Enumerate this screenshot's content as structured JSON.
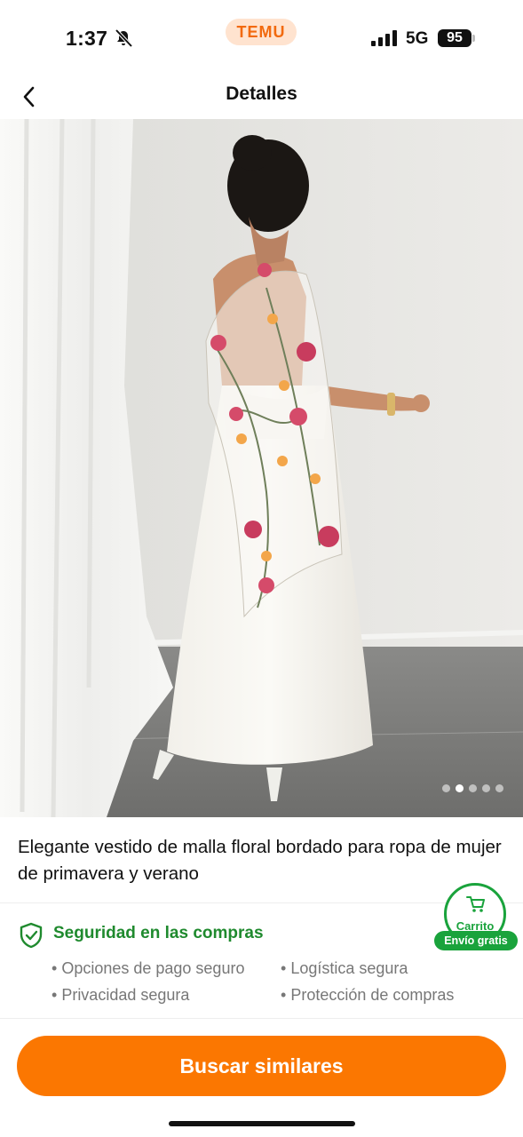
{
  "status_bar": {
    "time": "1:37",
    "app_badge": "TEMU",
    "network": "5G",
    "battery": "95"
  },
  "header": {
    "title": "Detalles"
  },
  "gallery": {
    "total_images": 5,
    "active_index": 1
  },
  "product": {
    "title": "Elegante vestido de malla floral bordado para ropa de mujer de primavera y verano"
  },
  "security": {
    "title": "Seguridad en las compras",
    "items": [
      "Opciones de pago seguro",
      "Logística segura",
      "Privacidad segura",
      "Protección de compras"
    ]
  },
  "cart": {
    "label": "Carrito",
    "badge": "Envío gratis"
  },
  "cta": {
    "label": "Buscar similares"
  },
  "colors": {
    "accent": "#fb7701",
    "green": "#1aa33c",
    "temu_orange": "#f26a0e"
  }
}
